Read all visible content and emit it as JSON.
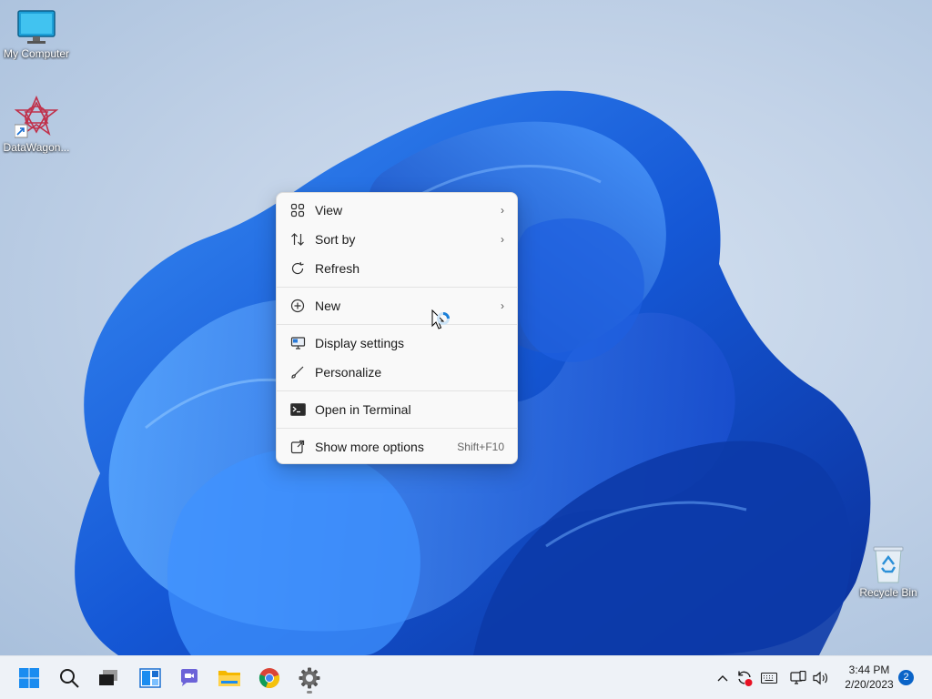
{
  "desktop": {
    "icons": [
      {
        "label": "My Computer"
      },
      {
        "label": "DataWagon..."
      },
      {
        "label": "Recycle Bin"
      }
    ]
  },
  "context_menu": {
    "items": [
      {
        "label": "View",
        "icon": "view-grid-icon",
        "submenu": true
      },
      {
        "label": "Sort by",
        "icon": "sort-icon",
        "submenu": true
      },
      {
        "label": "Refresh",
        "icon": "refresh-icon"
      },
      {
        "label": "New",
        "icon": "plus-circle-icon",
        "submenu": true
      },
      {
        "label": "Display settings",
        "icon": "display-icon"
      },
      {
        "label": "Personalize",
        "icon": "brush-icon"
      },
      {
        "label": "Open in Terminal",
        "icon": "terminal-icon"
      },
      {
        "label": "Show more options",
        "icon": "open-external-icon",
        "shortcut": "Shift+F10"
      }
    ],
    "chevron": "›"
  },
  "taskbar": {
    "apps": [
      "start-icon",
      "search-icon",
      "task-view-icon",
      "widgets-icon",
      "teams-chat-icon",
      "file-explorer-icon",
      "chrome-icon",
      "settings-icon"
    ],
    "tray": [
      "chevron-up-icon",
      "sync-icon",
      "keyboard-icon",
      "network-icon",
      "volume-icon"
    ],
    "clock": {
      "time": "3:44 PM",
      "date": "2/20/2023"
    },
    "notification_count": "2"
  },
  "colors": {
    "accent": "#0a64c8",
    "wallpaper_blue": "#1a5fd8",
    "menu_bg": "#f9f9f9"
  }
}
